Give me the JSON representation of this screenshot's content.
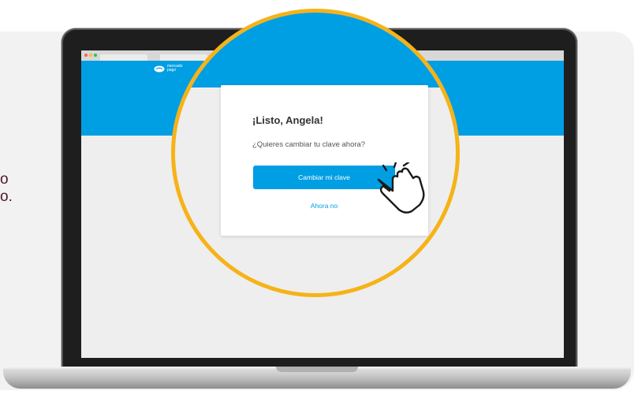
{
  "side_text": {
    "line1": "o",
    "line2": "o."
  },
  "laptop": {
    "app_logo_line1": "mercado",
    "app_logo_line2": "pago"
  },
  "dialog": {
    "title": "¡Listo, Angela!",
    "subtitle": "¿Quieres cambiar tu clave ahora?",
    "primary_button": "Cambiar mi clave",
    "secondary_link": "Ahora no"
  },
  "icons": {
    "cursor": "hand-pointer-icon",
    "logo": "handshake-icon"
  },
  "colors": {
    "brand_blue": "#009ee3",
    "highlight_ring": "#f6b318",
    "panel_bg": "#f2f2f2",
    "side_text": "#4c1a2c"
  }
}
